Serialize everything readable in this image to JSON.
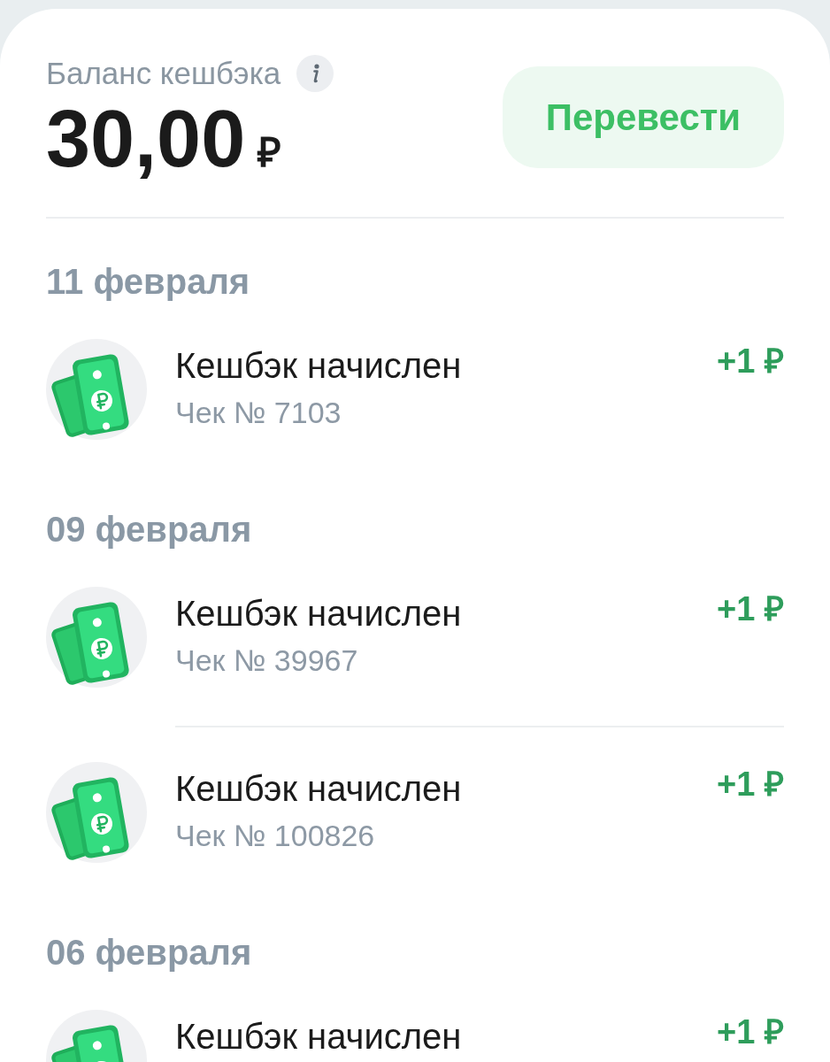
{
  "balance": {
    "label": "Баланс кешбэка",
    "amount": "30,00",
    "currency": "₽"
  },
  "transfer_button": {
    "label": "Перевести"
  },
  "groups": [
    {
      "date": "11 февраля",
      "items": [
        {
          "title": "Кешбэк начислен",
          "receipt": "Чек № 7103",
          "amount": "+1 ₽"
        }
      ]
    },
    {
      "date": "09 февраля",
      "items": [
        {
          "title": "Кешбэк начислен",
          "receipt": "Чек № 39967",
          "amount": "+1 ₽"
        },
        {
          "title": "Кешбэк начислен",
          "receipt": "Чек № 100826",
          "amount": "+1 ₽"
        }
      ]
    },
    {
      "date": "06 февраля",
      "items": [
        {
          "title": "Кешбэк начислен",
          "amount": "+1 ₽"
        }
      ]
    }
  ]
}
